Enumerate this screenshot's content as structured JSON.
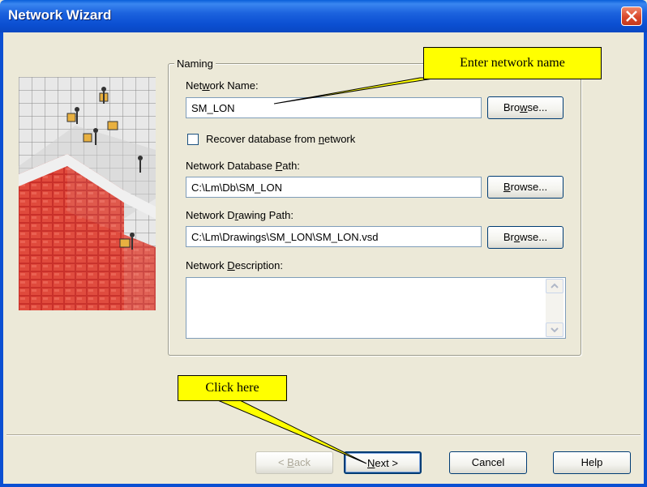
{
  "window": {
    "title": "Network Wizard"
  },
  "naming": {
    "legend": "Naming",
    "network_name": {
      "label_pre": "Net",
      "label_u": "w",
      "label_post": "ork Name:",
      "value": "SM_LON",
      "browse_pre": "Bro",
      "browse_u": "w",
      "browse_post": "se..."
    },
    "recover_checkbox": {
      "label_pre": "Recover database from ",
      "label_u": "n",
      "label_post": "etwork",
      "checked": false
    },
    "db_path": {
      "label_pre": "Network Database ",
      "label_u": "P",
      "label_post": "ath:",
      "value": "C:\\Lm\\Db\\SM_LON",
      "browse_pre": "",
      "browse_u": "B",
      "browse_post": "rowse..."
    },
    "drawing_path": {
      "label_pre": "Network D",
      "label_u": "r",
      "label_post": "awing Path:",
      "value": "C:\\Lm\\Drawings\\SM_LON\\SM_LON.vsd",
      "browse_pre": "Br",
      "browse_u": "o",
      "browse_post": "wse..."
    },
    "description": {
      "label_pre": "Network ",
      "label_u": "D",
      "label_post": "escription:",
      "value": ""
    }
  },
  "footer": {
    "back": {
      "pre": "< ",
      "u": "B",
      "post": "ack"
    },
    "next": {
      "pre": "",
      "u": "N",
      "post": "ext >"
    },
    "cancel": "Cancel",
    "help": "Help"
  },
  "callouts": {
    "enter_name": "Enter network name",
    "click_here": "Click here"
  },
  "colors": {
    "titlebar": "#0B4FD2",
    "dialog_bg": "#ECE9D8",
    "callout": "#FFFF00"
  }
}
